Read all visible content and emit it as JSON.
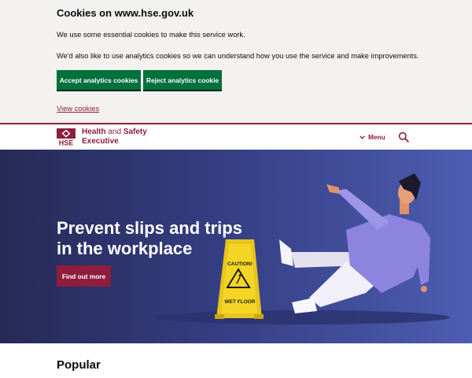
{
  "cookie_banner": {
    "title": "Cookies on www.hse.gov.uk",
    "text1": "We use some essential cookies to make this service work.",
    "text2": "We'd also like to use analytics cookies so we can understand how you use the service and make improvements.",
    "accept_label": "Accept analytics cookies",
    "reject_label": "Reject analytics cookie",
    "view_link": "View cookies"
  },
  "header": {
    "logo_text": "HSE",
    "brand_line1_a": "Health",
    "brand_line1_b": "and",
    "brand_line1_c": "Safety",
    "brand_line2": "Executive",
    "menu_label": "Menu",
    "menu_icon": "chevron-down-icon",
    "search_icon": "search-icon"
  },
  "hero": {
    "heading": "Prevent slips and trips in the workplace",
    "button_label": "Find out more",
    "sign_line1": "CAUTION!",
    "sign_line2": "WET FLOOR"
  },
  "popular": {
    "heading": "Popular"
  },
  "colors": {
    "brand": "#8f1d3c",
    "cookie_button": "#00703c",
    "cookie_bg": "#f3f2f1",
    "hero_dark": "#262a55",
    "hero_light": "#4d5db2"
  }
}
